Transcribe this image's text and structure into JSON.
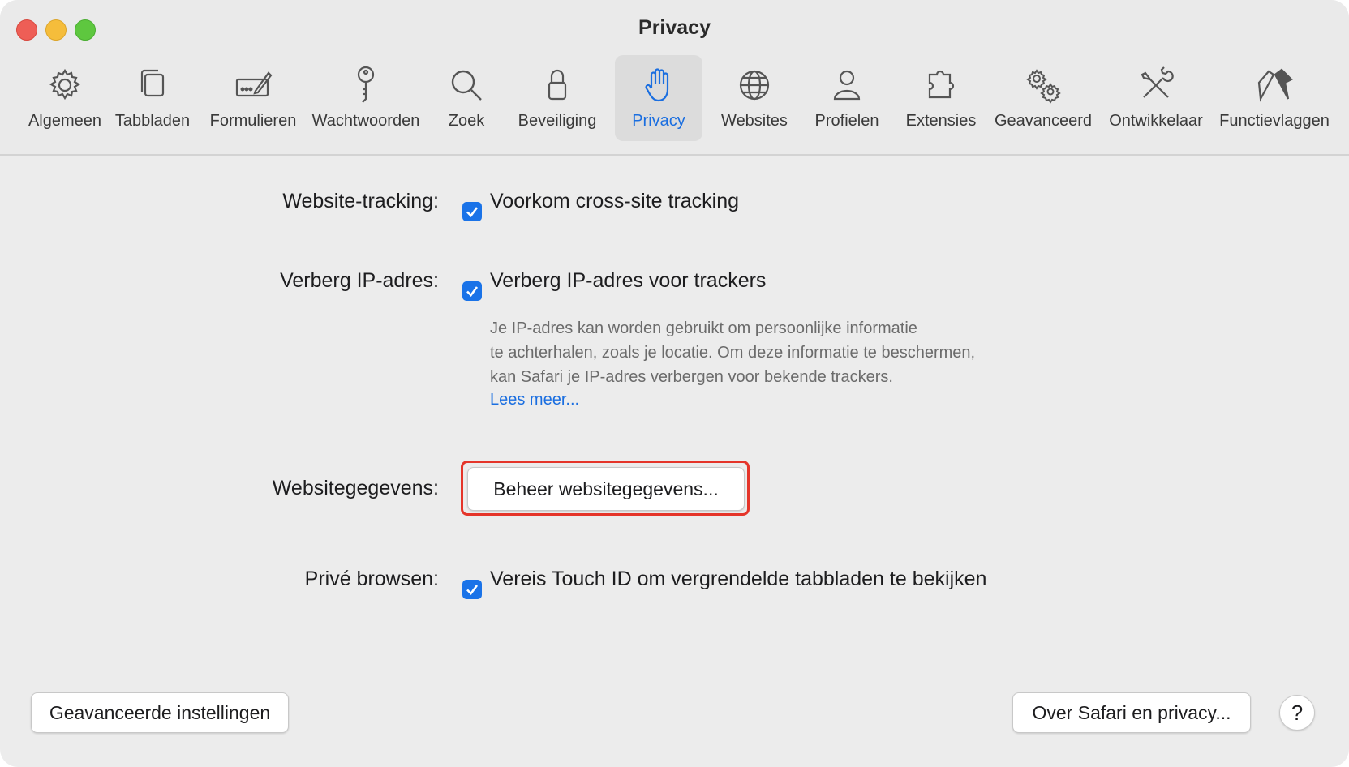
{
  "window": {
    "title": "Privacy"
  },
  "colors": {
    "accent": "#1a73e8",
    "highlight": "#e5352a"
  },
  "toolbar": {
    "tabs": [
      {
        "label": "Algemeen",
        "icon": "gear-icon"
      },
      {
        "label": "Tabbladen",
        "icon": "tabs-icon"
      },
      {
        "label": "Formulieren",
        "icon": "form-icon"
      },
      {
        "label": "Wachtwoorden",
        "icon": "key-icon"
      },
      {
        "label": "Zoek",
        "icon": "search-icon"
      },
      {
        "label": "Beveiliging",
        "icon": "lock-icon"
      },
      {
        "label": "Privacy",
        "icon": "hand-icon",
        "active": true
      },
      {
        "label": "Websites",
        "icon": "globe-icon"
      },
      {
        "label": "Profielen",
        "icon": "person-icon"
      },
      {
        "label": "Extensies",
        "icon": "puzzle-icon"
      },
      {
        "label": "Geavanceerd",
        "icon": "gears-icon"
      },
      {
        "label": "Ontwikkelaar",
        "icon": "tools-icon"
      },
      {
        "label": "Functievlaggen",
        "icon": "flags-icon"
      }
    ]
  },
  "settings": {
    "tracking": {
      "label": "Website-tracking:",
      "option": "Voorkom cross-site tracking",
      "checked": true
    },
    "hide_ip": {
      "label": "Verberg IP-adres:",
      "option": "Verberg IP-adres voor trackers",
      "checked": true,
      "description": [
        "Je IP-adres kan worden gebruikt om persoonlijke informatie",
        "te achterhalen, zoals je locatie. Om deze informatie te beschermen,",
        "kan Safari je IP-adres verbergen voor bekende trackers."
      ],
      "link": "Lees meer..."
    },
    "website_data": {
      "label": "Websitegegevens:",
      "button": "Beheer websitegegevens..."
    },
    "private": {
      "label": "Privé browsen:",
      "option": "Vereis Touch ID om vergrendelde tabbladen te bekijken",
      "checked": true
    }
  },
  "footer": {
    "advanced_button": "Geavanceerde instellingen",
    "about_button": "Over Safari en privacy...",
    "help_button": "?"
  }
}
